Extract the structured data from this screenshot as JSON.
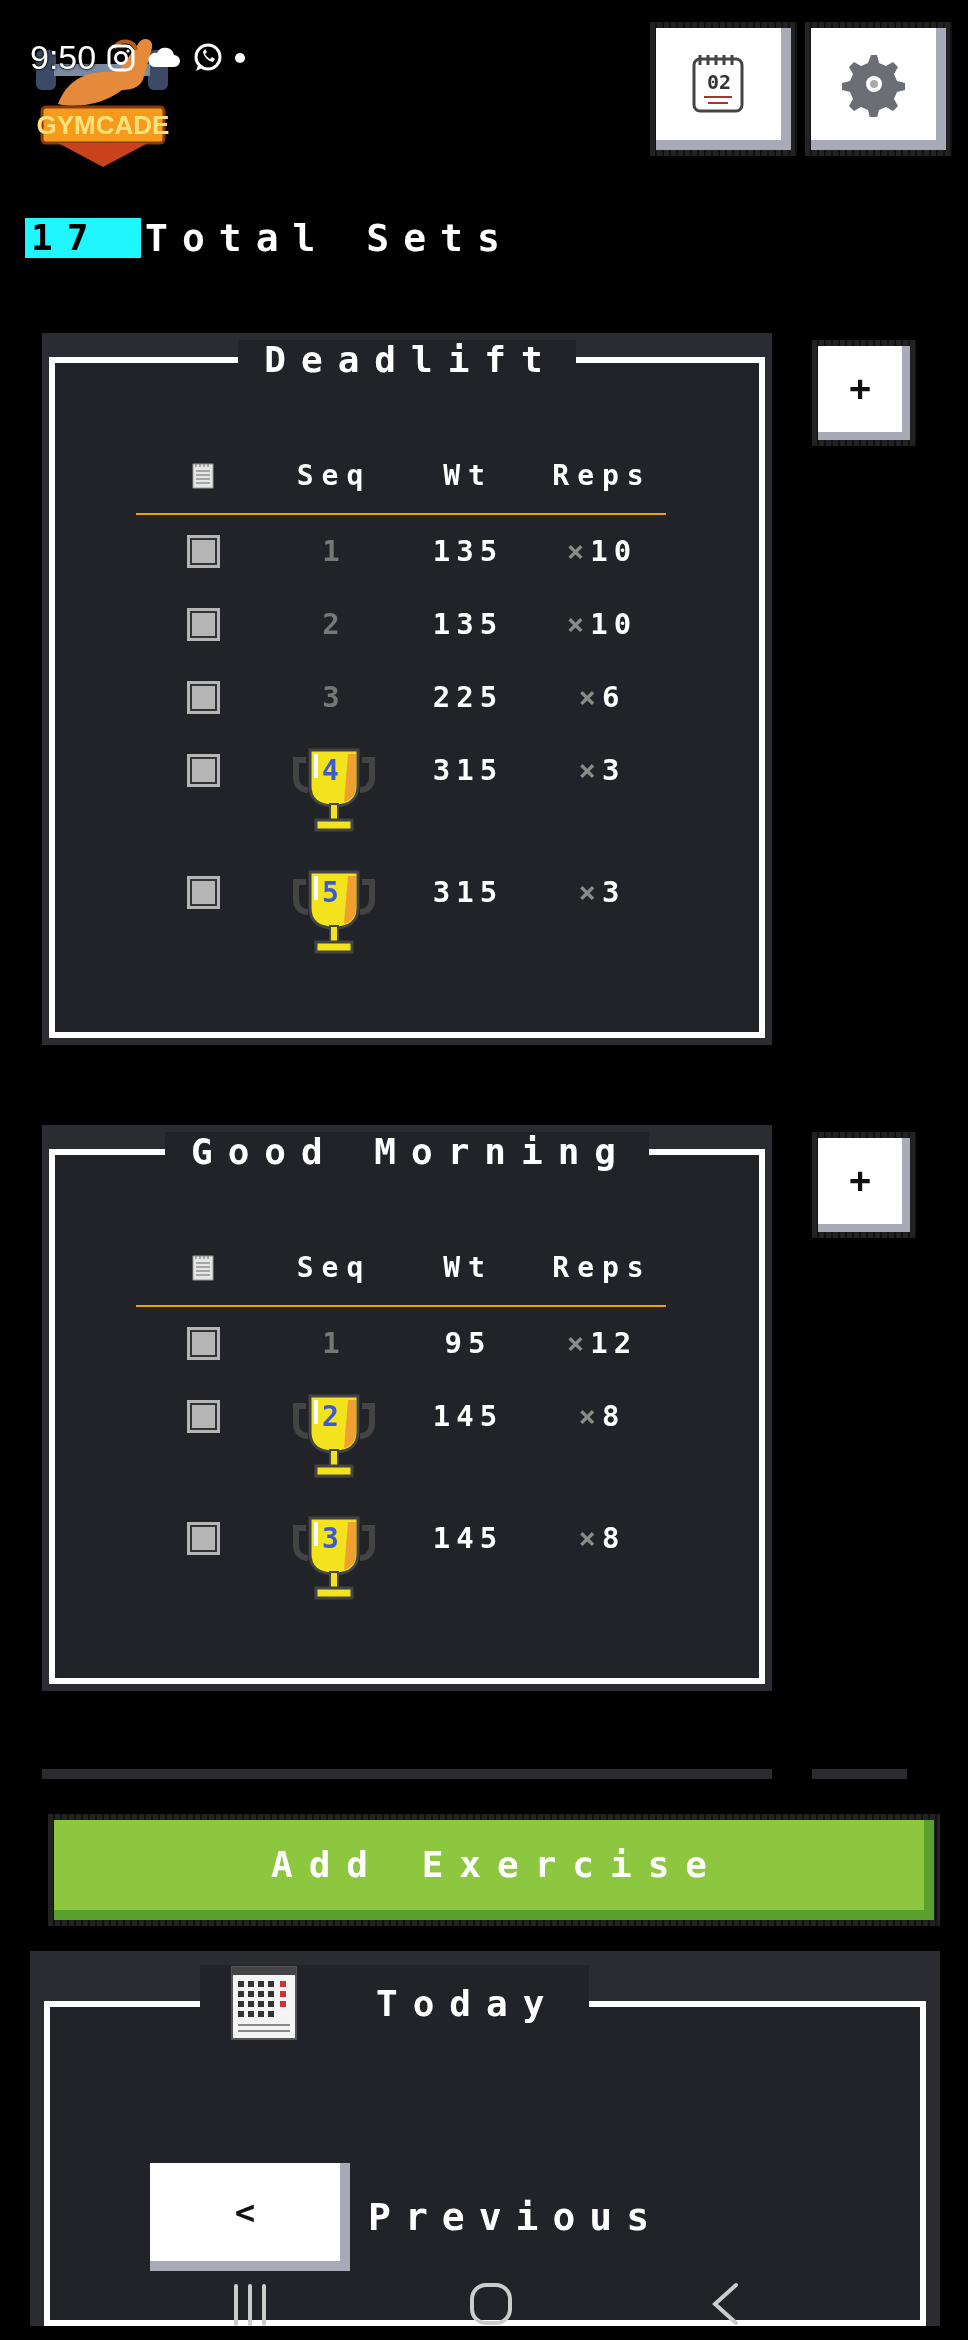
{
  "status_bar": {
    "time": "9:50"
  },
  "app": {
    "logo_text": "GYMCADE",
    "calendar_day": "02"
  },
  "summary": {
    "count": "17",
    "label": "Total Sets"
  },
  "exercises": [
    {
      "name": "Deadlift",
      "add_label": "+",
      "columns": [
        "Seq",
        "Wt",
        "Reps"
      ],
      "sets": [
        {
          "seq": "1",
          "weight": "135",
          "times": "×",
          "reps": "10",
          "pr": false,
          "checked": false
        },
        {
          "seq": "2",
          "weight": "135",
          "times": "×",
          "reps": "10",
          "pr": false,
          "checked": false
        },
        {
          "seq": "3",
          "weight": "225",
          "times": "×",
          "reps": "6",
          "pr": false,
          "checked": false
        },
        {
          "seq": "4",
          "weight": "315",
          "times": "×",
          "reps": "3",
          "pr": true,
          "checked": false
        },
        {
          "seq": "5",
          "weight": "315",
          "times": "×",
          "reps": "3",
          "pr": true,
          "checked": false
        }
      ]
    },
    {
      "name": "Good Morning",
      "add_label": "+",
      "columns": [
        "Seq",
        "Wt",
        "Reps"
      ],
      "sets": [
        {
          "seq": "1",
          "weight": "95",
          "times": "×",
          "reps": "12",
          "pr": false,
          "checked": false
        },
        {
          "seq": "2",
          "weight": "145",
          "times": "×",
          "reps": "8",
          "pr": true,
          "checked": false
        },
        {
          "seq": "3",
          "weight": "145",
          "times": "×",
          "reps": "8",
          "pr": true,
          "checked": false
        }
      ]
    }
  ],
  "add_exercise": "Add Exercise",
  "date_nav": {
    "title": "Today",
    "prev_symbol": "<",
    "prev_label": "Previous"
  }
}
